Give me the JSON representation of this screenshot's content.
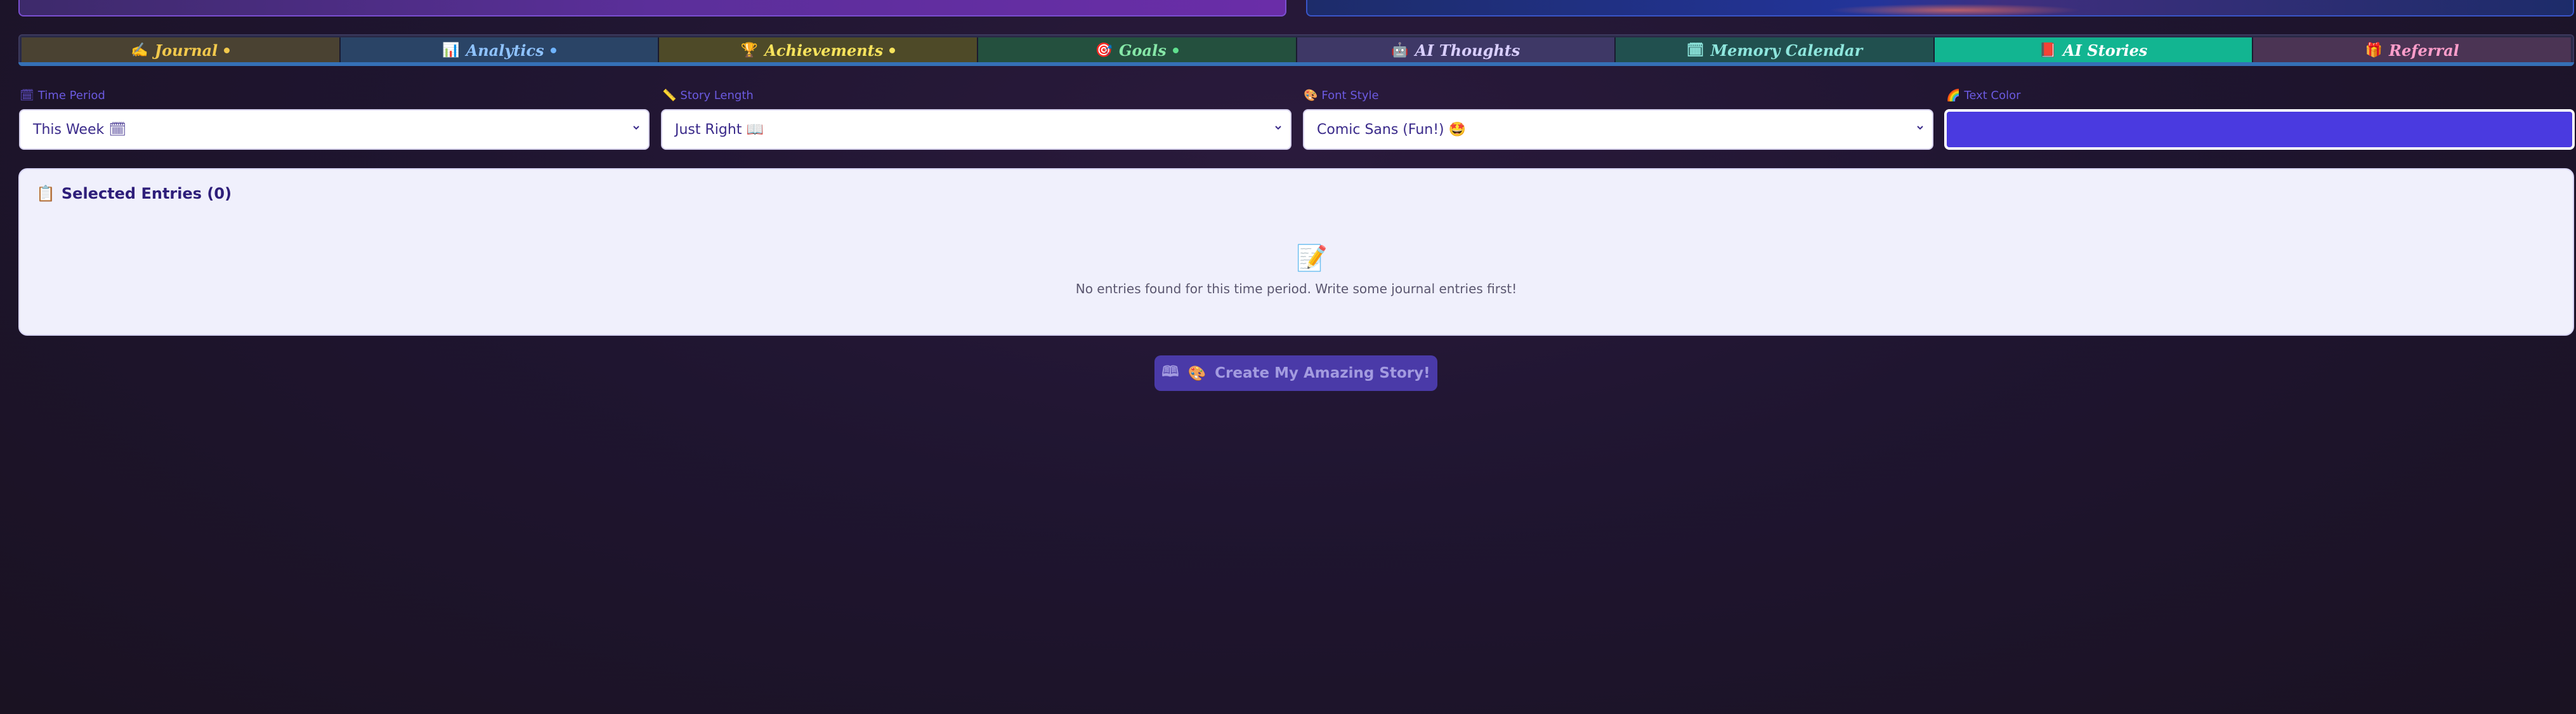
{
  "tabs": [
    {
      "icon": "✍️",
      "label": "Journal"
    },
    {
      "icon": "📊",
      "label": "Analytics"
    },
    {
      "icon": "🏆",
      "label": "Achievements"
    },
    {
      "icon": "🎯",
      "label": "Goals"
    },
    {
      "icon": "🤖",
      "label": "AI Thoughts"
    },
    {
      "icon": "🗓",
      "label": "Memory Calendar"
    },
    {
      "icon": "📕",
      "label": "AI Stories"
    },
    {
      "icon": "🎁",
      "label": "Referral"
    }
  ],
  "active_tab": "AI Stories",
  "controls": {
    "time_period": {
      "icon": "🗓",
      "label": "Time Period",
      "value": "This Week 🗓"
    },
    "story_length": {
      "icon": "📏",
      "label": "Story Length",
      "value": "Just Right 📖"
    },
    "font_style": {
      "icon": "🎨",
      "label": "Font Style",
      "value": "Comic Sans (Fun!) 🤩"
    },
    "text_color": {
      "icon": "🌈",
      "label": "Text Color",
      "value": "#4a3ae0"
    }
  },
  "selected_entries": {
    "icon": "📋",
    "title": "Selected Entries (0)",
    "empty_icon": "📝",
    "empty_message": "No entries found for this time period. Write some journal entries first!"
  },
  "create_button": {
    "book_icon": "🕮",
    "emoji": "🎨",
    "label": "Create My Amazing Story!"
  },
  "colors": {
    "active_tab": "#12b591",
    "accent": "#6b5ae0",
    "button": "#4a3aa8"
  }
}
